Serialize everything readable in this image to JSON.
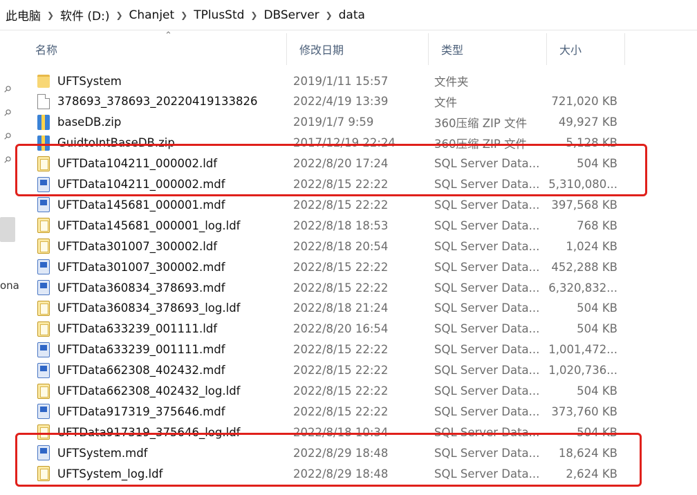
{
  "breadcrumb": [
    "此电脑",
    "软件 (D:)",
    "Chanjet",
    "TPlusStd",
    "DBServer",
    "data"
  ],
  "left_pane_fragment": "ona",
  "columns": {
    "name": "名称",
    "date": "修改日期",
    "type": "类型",
    "size": "大小"
  },
  "files": [
    {
      "name": "UFTSystem",
      "date": "2019/1/11 15:57",
      "type": "文件夹",
      "size": "",
      "icon": "folder-icon"
    },
    {
      "name": "378693_378693_20220419133826",
      "date": "2022/4/19 13:39",
      "type": "文件",
      "size": "721,020 KB",
      "icon": "file-icon"
    },
    {
      "name": "baseDB.zip",
      "date": "2019/1/7 9:59",
      "type": "360压缩 ZIP 文件",
      "size": "49,927 KB",
      "icon": "zip-icon"
    },
    {
      "name": "GuidtoIntBaseDB.zip",
      "date": "2017/12/19 22:24",
      "type": "360压缩 ZIP 文件",
      "size": "5,128 KB",
      "icon": "zip-icon"
    },
    {
      "name": "UFTData104211_000002.ldf",
      "date": "2022/8/20 17:24",
      "type": "SQL Server Data...",
      "size": "504 KB",
      "icon": "ldf-icon"
    },
    {
      "name": "UFTData104211_000002.mdf",
      "date": "2022/8/15 22:22",
      "type": "SQL Server Data...",
      "size": "5,310,080...",
      "icon": "mdf-icon"
    },
    {
      "name": "UFTData145681_000001.mdf",
      "date": "2022/8/15 22:22",
      "type": "SQL Server Data...",
      "size": "397,568 KB",
      "icon": "mdf-icon"
    },
    {
      "name": "UFTData145681_000001_log.ldf",
      "date": "2022/8/18 18:53",
      "type": "SQL Server Data...",
      "size": "768 KB",
      "icon": "ldf-icon"
    },
    {
      "name": "UFTData301007_300002.ldf",
      "date": "2022/8/18 20:54",
      "type": "SQL Server Data...",
      "size": "1,024 KB",
      "icon": "ldf-icon"
    },
    {
      "name": "UFTData301007_300002.mdf",
      "date": "2022/8/15 22:22",
      "type": "SQL Server Data...",
      "size": "452,288 KB",
      "icon": "mdf-icon"
    },
    {
      "name": "UFTData360834_378693.mdf",
      "date": "2022/8/15 22:22",
      "type": "SQL Server Data...",
      "size": "6,320,832...",
      "icon": "mdf-icon"
    },
    {
      "name": "UFTData360834_378693_log.ldf",
      "date": "2022/8/18 21:24",
      "type": "SQL Server Data...",
      "size": "504 KB",
      "icon": "ldf-icon"
    },
    {
      "name": "UFTData633239_001111.ldf",
      "date": "2022/8/20 16:54",
      "type": "SQL Server Data...",
      "size": "504 KB",
      "icon": "ldf-icon"
    },
    {
      "name": "UFTData633239_001111.mdf",
      "date": "2022/8/15 22:22",
      "type": "SQL Server Data...",
      "size": "1,001,472...",
      "icon": "mdf-icon"
    },
    {
      "name": "UFTData662308_402432.mdf",
      "date": "2022/8/15 22:22",
      "type": "SQL Server Data...",
      "size": "1,020,736...",
      "icon": "mdf-icon"
    },
    {
      "name": "UFTData662308_402432_log.ldf",
      "date": "2022/8/15 22:22",
      "type": "SQL Server Data...",
      "size": "504 KB",
      "icon": "ldf-icon"
    },
    {
      "name": "UFTData917319_375646.mdf",
      "date": "2022/8/15 22:22",
      "type": "SQL Server Data...",
      "size": "373,760 KB",
      "icon": "mdf-icon"
    },
    {
      "name": "UFTData917319_375646_log.ldf",
      "date": "2022/8/18 10:34",
      "type": "SQL Server Data...",
      "size": "504 KB",
      "icon": "ldf-icon"
    },
    {
      "name": "UFTSystem.mdf",
      "date": "2022/8/29 18:48",
      "type": "SQL Server Data...",
      "size": "18,624 KB",
      "icon": "mdf-icon"
    },
    {
      "name": "UFTSystem_log.ldf",
      "date": "2022/8/29 18:48",
      "type": "SQL Server Data...",
      "size": "2,624 KB",
      "icon": "ldf-icon"
    }
  ],
  "highlight_color": "#e0201b"
}
